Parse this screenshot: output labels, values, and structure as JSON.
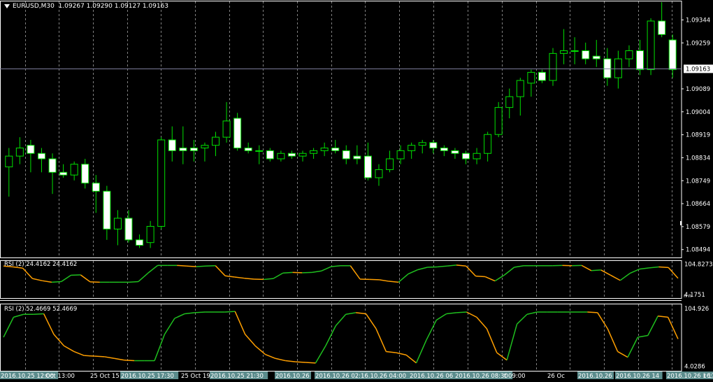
{
  "window": {
    "symbol": "EURUSD,M30",
    "ohlc": "1.09267 1.09290 1.09127 1.09163"
  },
  "colors": {
    "bull_body": "#000000",
    "bear_body": "#ffffff",
    "wick": "#00e000",
    "grid": "#808080",
    "rsi_up": "#1fbf1f",
    "rsi_down": "#ff9f00",
    "price_line": "#8080a0",
    "axis": "#ffffff"
  },
  "chart_data": [
    {
      "type": "candlestick",
      "title": "EURUSD,M30",
      "ylim": [
        1.0847,
        1.0941
      ],
      "y_ticks": [
        "1.09344",
        "1.09259",
        "1.09163",
        "1.09089",
        "1.09004",
        "1.08919",
        "1.08834",
        "1.08749",
        "1.08664",
        "1.08579",
        "1.08494"
      ],
      "current_price": "1.09163",
      "x_tick_labels": [
        "2016.10.25 12:00",
        "Oct 13:00",
        "25 Oct 15",
        "2016.10.25 17:30",
        "25 Oct 19",
        "2016.10.25 21:30",
        "2016.10.26",
        "2016.10.26 02:00",
        "16.10.26 04:00",
        "2016.10.26 06",
        "2016.10.26 08:30",
        "t 09:00",
        "26 Oc",
        "2016.10.26",
        "2016.10.26 14",
        "2016.10.26 16:30",
        "r 17:00"
      ],
      "candles": [
        {
          "o": 1.088,
          "h": 1.0887,
          "l": 1.0869,
          "c": 1.0884
        },
        {
          "o": 1.0884,
          "h": 1.0891,
          "l": 1.0881,
          "c": 1.0887
        },
        {
          "o": 1.0888,
          "h": 1.089,
          "l": 1.0878,
          "c": 1.0885
        },
        {
          "o": 1.0885,
          "h": 1.0887,
          "l": 1.0878,
          "c": 1.0883
        },
        {
          "o": 1.0883,
          "h": 1.0885,
          "l": 1.087,
          "c": 1.0878
        },
        {
          "o": 1.0878,
          "h": 1.0881,
          "l": 1.0876,
          "c": 1.0877
        },
        {
          "o": 1.0877,
          "h": 1.0882,
          "l": 1.0875,
          "c": 1.0881
        },
        {
          "o": 1.0881,
          "h": 1.0883,
          "l": 1.0872,
          "c": 1.0874
        },
        {
          "o": 1.0874,
          "h": 1.0877,
          "l": 1.0863,
          "c": 1.0871
        },
        {
          "o": 1.0871,
          "h": 1.0873,
          "l": 1.0853,
          "c": 1.0857
        },
        {
          "o": 1.0857,
          "h": 1.0864,
          "l": 1.0851,
          "c": 1.0861
        },
        {
          "o": 1.0861,
          "h": 1.0864,
          "l": 1.0852,
          "c": 1.0853
        },
        {
          "o": 1.0853,
          "h": 1.0855,
          "l": 1.085,
          "c": 1.0851
        },
        {
          "o": 1.0852,
          "h": 1.086,
          "l": 1.085,
          "c": 1.0858
        },
        {
          "o": 1.0858,
          "h": 1.0891,
          "l": 1.0857,
          "c": 1.089
        },
        {
          "o": 1.089,
          "h": 1.0895,
          "l": 1.0882,
          "c": 1.0886
        },
        {
          "o": 1.0887,
          "h": 1.0895,
          "l": 1.0881,
          "c": 1.0886
        },
        {
          "o": 1.0887,
          "h": 1.089,
          "l": 1.0882,
          "c": 1.0886
        },
        {
          "o": 1.0887,
          "h": 1.0889,
          "l": 1.0882,
          "c": 1.0888
        },
        {
          "o": 1.0888,
          "h": 1.0893,
          "l": 1.0884,
          "c": 1.0891
        },
        {
          "o": 1.0891,
          "h": 1.0904,
          "l": 1.0889,
          "c": 1.0897
        },
        {
          "o": 1.0898,
          "h": 1.09,
          "l": 1.0886,
          "c": 1.0887
        },
        {
          "o": 1.0887,
          "h": 1.0889,
          "l": 1.0885,
          "c": 1.0886
        },
        {
          "o": 1.0886,
          "h": 1.0888,
          "l": 1.0881,
          "c": 1.0886
        },
        {
          "o": 1.0886,
          "h": 1.0887,
          "l": 1.0882,
          "c": 1.0883
        },
        {
          "o": 1.0883,
          "h": 1.0886,
          "l": 1.0882,
          "c": 1.0885
        },
        {
          "o": 1.0885,
          "h": 1.0886,
          "l": 1.0883,
          "c": 1.0884
        },
        {
          "o": 1.0884,
          "h": 1.0886,
          "l": 1.0882,
          "c": 1.0885
        },
        {
          "o": 1.0885,
          "h": 1.0887,
          "l": 1.0883,
          "c": 1.0886
        },
        {
          "o": 1.0886,
          "h": 1.0889,
          "l": 1.0884,
          "c": 1.0887
        },
        {
          "o": 1.0887,
          "h": 1.089,
          "l": 1.0885,
          "c": 1.0886
        },
        {
          "o": 1.0886,
          "h": 1.0888,
          "l": 1.0881,
          "c": 1.0883
        },
        {
          "o": 1.0884,
          "h": 1.0888,
          "l": 1.0881,
          "c": 1.0883
        },
        {
          "o": 1.0884,
          "h": 1.0889,
          "l": 1.0875,
          "c": 1.0876
        },
        {
          "o": 1.0876,
          "h": 1.0881,
          "l": 1.0873,
          "c": 1.0879
        },
        {
          "o": 1.0879,
          "h": 1.0886,
          "l": 1.0878,
          "c": 1.0883
        },
        {
          "o": 1.0883,
          "h": 1.0888,
          "l": 1.0881,
          "c": 1.0886
        },
        {
          "o": 1.0886,
          "h": 1.0889,
          "l": 1.0883,
          "c": 1.0888
        },
        {
          "o": 1.0888,
          "h": 1.089,
          "l": 1.0885,
          "c": 1.0889
        },
        {
          "o": 1.0889,
          "h": 1.089,
          "l": 1.0885,
          "c": 1.0887
        },
        {
          "o": 1.0887,
          "h": 1.0888,
          "l": 1.0884,
          "c": 1.0886
        },
        {
          "o": 1.0886,
          "h": 1.0887,
          "l": 1.0883,
          "c": 1.0885
        },
        {
          "o": 1.0885,
          "h": 1.0886,
          "l": 1.0881,
          "c": 1.0883
        },
        {
          "o": 1.0883,
          "h": 1.0887,
          "l": 1.0881,
          "c": 1.0885
        },
        {
          "o": 1.0885,
          "h": 1.0893,
          "l": 1.0882,
          "c": 1.0892
        },
        {
          "o": 1.0892,
          "h": 1.0904,
          "l": 1.0891,
          "c": 1.0902
        },
        {
          "o": 1.0902,
          "h": 1.0909,
          "l": 1.0898,
          "c": 1.0906
        },
        {
          "o": 1.0906,
          "h": 1.0913,
          "l": 1.0899,
          "c": 1.0912
        },
        {
          "o": 1.0911,
          "h": 1.0916,
          "l": 1.0906,
          "c": 1.0915
        },
        {
          "o": 1.0915,
          "h": 1.0916,
          "l": 1.0911,
          "c": 1.0912
        },
        {
          "o": 1.0912,
          "h": 1.0924,
          "l": 1.091,
          "c": 1.0922
        },
        {
          "o": 1.0922,
          "h": 1.0931,
          "l": 1.0918,
          "c": 1.0923
        },
        {
          "o": 1.0923,
          "h": 1.0928,
          "l": 1.0918,
          "c": 1.0923
        },
        {
          "o": 1.0923,
          "h": 1.0926,
          "l": 1.0918,
          "c": 1.092
        },
        {
          "o": 1.0921,
          "h": 1.0927,
          "l": 1.0917,
          "c": 1.092
        },
        {
          "o": 1.092,
          "h": 1.0924,
          "l": 1.091,
          "c": 1.0913
        },
        {
          "o": 1.0913,
          "h": 1.0923,
          "l": 1.0909,
          "c": 1.092
        },
        {
          "o": 1.092,
          "h": 1.0925,
          "l": 1.0917,
          "c": 1.0923
        },
        {
          "o": 1.0923,
          "h": 1.0927,
          "l": 1.0914,
          "c": 1.0916
        },
        {
          "o": 1.0916,
          "h": 1.0935,
          "l": 1.0914,
          "c": 1.0934
        },
        {
          "o": 1.0934,
          "h": 1.0941,
          "l": 1.0928,
          "c": 1.0929
        },
        {
          "o": 1.0927,
          "h": 1.0929,
          "l": 1.0913,
          "c": 1.0916
        }
      ]
    },
    {
      "type": "line",
      "title": "RSI (2) 24.4162 24.4162",
      "ylim": [
        0,
        110
      ],
      "y_ticks": [
        "104.8273",
        "4.1751"
      ],
      "values": [
        98,
        95,
        91,
        57,
        50,
        45,
        47,
        68,
        69,
        46,
        45,
        45,
        45,
        45,
        47,
        75,
        100,
        100,
        100,
        98,
        96,
        98,
        99,
        66,
        62,
        58,
        55,
        54,
        57,
        75,
        77,
        76,
        77,
        82,
        96,
        99,
        99,
        55,
        54,
        53,
        48,
        45,
        72,
        86,
        94,
        95,
        98,
        101,
        98,
        65,
        63,
        49,
        69,
        94,
        99,
        99,
        99,
        99,
        100,
        99,
        100,
        83,
        85,
        68,
        51,
        74,
        88,
        92,
        95,
        93,
        58
      ]
    },
    {
      "type": "line",
      "title": "RSI (2) 52.4669 52.4669",
      "ylim": [
        0,
        110
      ],
      "y_ticks": [
        "104.926",
        "4.0286"
      ],
      "values": [
        55,
        90,
        95,
        95,
        96,
        60,
        40,
        30,
        23,
        22,
        21,
        18,
        15,
        14,
        14,
        14,
        60,
        88,
        96,
        98,
        99,
        99,
        99,
        100,
        60,
        40,
        25,
        18,
        14,
        12,
        11,
        10,
        40,
        75,
        95,
        98,
        96,
        70,
        30,
        28,
        24,
        10,
        50,
        85,
        96,
        98,
        99,
        90,
        70,
        28,
        15,
        78,
        95,
        99,
        99,
        99,
        99,
        99,
        99,
        98,
        70,
        30,
        20,
        55,
        58,
        92,
        90,
        52
      ]
    }
  ],
  "rsi_scale_marker": "n n"
}
